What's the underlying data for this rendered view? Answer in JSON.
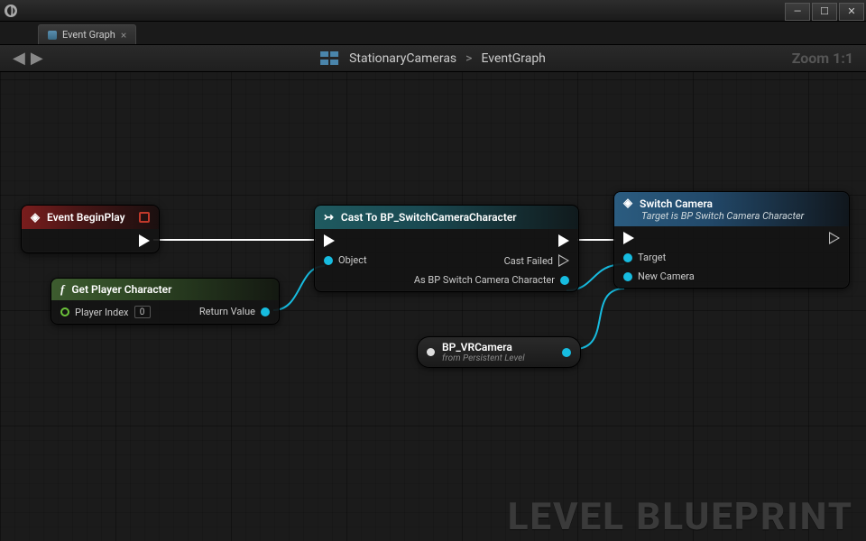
{
  "window": {
    "title": ""
  },
  "tab": {
    "label": "Event Graph"
  },
  "breadcrumb": {
    "parent": "StationaryCameras",
    "current": "EventGraph",
    "separator": ">"
  },
  "zoom": "Zoom 1:1",
  "nodes": {
    "eventBeginPlay": {
      "title": "Event BeginPlay"
    },
    "getPlayerCharacter": {
      "title": "Get Player Character",
      "playerIndexLabel": "Player Index",
      "playerIndexValue": "0",
      "returnLabel": "Return Value"
    },
    "castTo": {
      "title": "Cast To BP_SwitchCameraCharacter",
      "objectLabel": "Object",
      "castFailedLabel": "Cast Failed",
      "asLabel": "As BP Switch Camera Character"
    },
    "switchCamera": {
      "title": "Switch Camera",
      "subtitle": "Target is BP Switch Camera Character",
      "targetLabel": "Target",
      "newCameraLabel": "New Camera"
    },
    "vrCamera": {
      "title": "BP_VRCamera",
      "sub": "from Persistent Level"
    }
  },
  "watermark": "LEVEL BLUEPRINT"
}
